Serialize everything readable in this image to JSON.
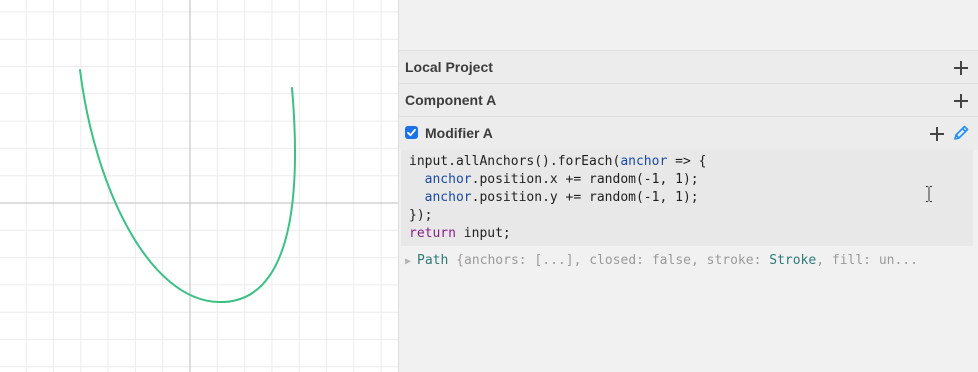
{
  "layers": [
    {
      "label": "Local Project"
    },
    {
      "label": "Component A"
    }
  ],
  "modifier": {
    "label": "Modifier A",
    "checked": true
  },
  "code": {
    "l1_a": "input.allAnchors().forEach(",
    "l1_b": "anchor",
    "l1_c": " => {",
    "l2_a": "  ",
    "l2_b": "anchor",
    "l2_c": ".position.x += random(-1, 1);",
    "l3_a": "  ",
    "l3_b": "anchor",
    "l3_c": ".position.y += random(-1, 1);",
    "l4": "});",
    "l5_kw": "return",
    "l5_rest": " input;"
  },
  "output": {
    "type": "Path",
    "text_a": " {anchors: [...], closed: false, stroke: ",
    "stroke": "Stroke",
    "text_b": ", fill: un..."
  },
  "colors": {
    "curve": "#3cc184",
    "grid": "#ececec",
    "axis": "#bdbdbd",
    "checkbox": "#1a73e8",
    "edit_icon": "#1e90ff"
  },
  "icons": {
    "add": "plus-icon",
    "edit": "pencil-icon",
    "expand": "triangle-right-icon",
    "text_cursor": "ibeam-cursor-icon"
  }
}
